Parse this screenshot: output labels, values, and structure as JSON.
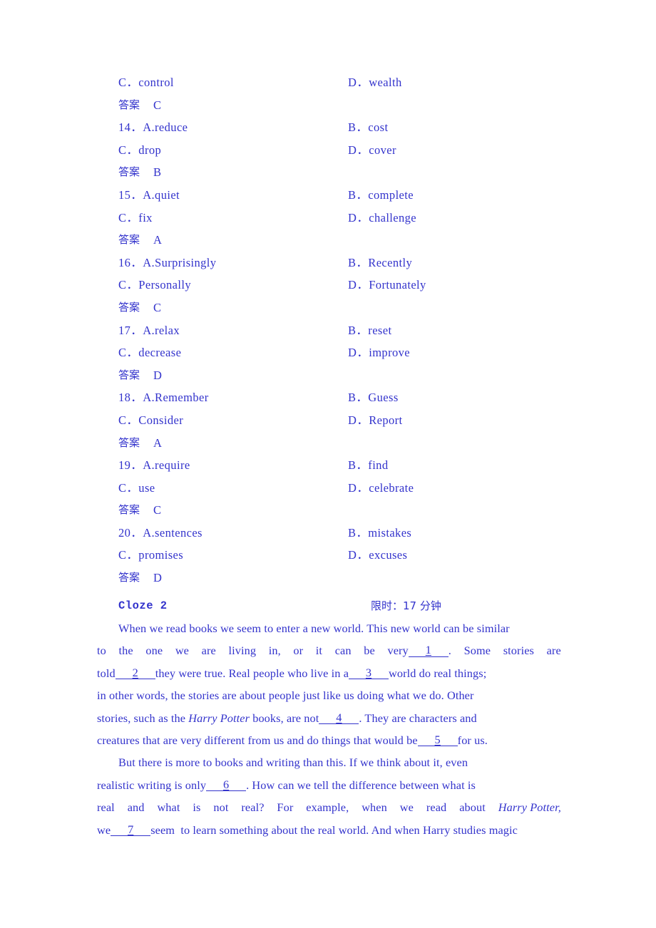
{
  "document": {
    "text_color": "#3333cc",
    "background_color": "#ffffff"
  },
  "options_block": {
    "rows": [
      {
        "type": "options",
        "left": "C．control",
        "right": "D．wealth"
      },
      {
        "type": "answer",
        "label": "答案",
        "value": "C"
      },
      {
        "type": "options",
        "left": "14．A.reduce",
        "right": "B．cost"
      },
      {
        "type": "options",
        "left": "C．drop",
        "right": "D．cover"
      },
      {
        "type": "answer",
        "label": "答案",
        "value": "B"
      },
      {
        "type": "options",
        "left": "15．A.quiet",
        "right": "B．complete"
      },
      {
        "type": "options",
        "left": "C．fix",
        "right": "D．challenge"
      },
      {
        "type": "answer",
        "label": "答案",
        "value": "A"
      },
      {
        "type": "options",
        "left": "16．A.Surprisingly",
        "right": "B．Recently"
      },
      {
        "type": "options",
        "left": "C．Personally",
        "right": "D．Fortunately"
      },
      {
        "type": "answer",
        "label": "答案",
        "value": "C"
      },
      {
        "type": "options",
        "left": "17．A.relax",
        "right": "B．reset"
      },
      {
        "type": "options",
        "left": "C．decrease",
        "right": "D．improve"
      },
      {
        "type": "answer",
        "label": "答案",
        "value": "D"
      },
      {
        "type": "options",
        "left": "18．A.Remember",
        "right": "B．Guess"
      },
      {
        "type": "options",
        "left": "C．Consider",
        "right": "D．Report"
      },
      {
        "type": "answer",
        "label": "答案",
        "value": "A"
      },
      {
        "type": "options",
        "left": "19．A.require",
        "right": "B．find"
      },
      {
        "type": "options",
        "left": "C．use",
        "right": "D．celebrate"
      },
      {
        "type": "answer",
        "label": "答案",
        "value": "C"
      },
      {
        "type": "options",
        "left": "20．A.sentences",
        "right": "B．mistakes"
      },
      {
        "type": "options",
        "left": "C．promises",
        "right": "D．excuses"
      },
      {
        "type": "answer",
        "label": "答案",
        "value": "D"
      }
    ]
  },
  "cloze_header": {
    "title": "Cloze 2",
    "time_limit": "限时：17 分钟"
  },
  "passage": {
    "lines": [
      {
        "justify": false,
        "indent": true,
        "segments": [
          {
            "kind": "text",
            "value": "When we read books we seem to enter a new world. This new world can be similar"
          }
        ]
      },
      {
        "justify": true,
        "indent": false,
        "segments": [
          {
            "kind": "text",
            "value": "to"
          },
          {
            "kind": "text",
            "value": "the"
          },
          {
            "kind": "text",
            "value": "one"
          },
          {
            "kind": "text",
            "value": "we"
          },
          {
            "kind": "text",
            "value": "are"
          },
          {
            "kind": "text",
            "value": "living"
          },
          {
            "kind": "text",
            "value": "in,"
          },
          {
            "kind": "text",
            "value": "or"
          },
          {
            "kind": "text",
            "value": "it"
          },
          {
            "kind": "text",
            "value": "can"
          },
          {
            "kind": "text",
            "value": "be"
          },
          {
            "kind": "group",
            "parts": [
              {
                "kind": "text",
                "value": "very"
              },
              {
                "kind": "blank",
                "value": "1"
              },
              {
                "kind": "text",
                "value": "."
              }
            ]
          },
          {
            "kind": "text",
            "value": "Some"
          },
          {
            "kind": "text",
            "value": "stories"
          },
          {
            "kind": "text",
            "value": "are"
          }
        ]
      },
      {
        "justify": false,
        "indent": false,
        "segments": [
          {
            "kind": "text",
            "value": "told"
          },
          {
            "kind": "blank",
            "value": "2"
          },
          {
            "kind": "text",
            "value": "they were true. Real people who live in a"
          },
          {
            "kind": "blank",
            "value": "3"
          },
          {
            "kind": "text",
            "value": "world do real things;"
          }
        ]
      },
      {
        "justify": false,
        "indent": false,
        "segments": [
          {
            "kind": "text",
            "value": "in other words, the stories are about people just like us doing what we do. Other"
          }
        ]
      },
      {
        "justify": false,
        "indent": false,
        "segments": [
          {
            "kind": "text",
            "value": "stories, such as the "
          },
          {
            "kind": "italic",
            "value": "Harry Potter"
          },
          {
            "kind": "text",
            "value": " books, are not"
          },
          {
            "kind": "blank",
            "value": "4"
          },
          {
            "kind": "text",
            "value": ". They are characters and"
          }
        ]
      },
      {
        "justify": false,
        "indent": false,
        "segments": [
          {
            "kind": "text",
            "value": "creatures that are very different from us and do things that would be"
          },
          {
            "kind": "blank",
            "value": "5"
          },
          {
            "kind": "text",
            "value": "for us."
          }
        ]
      },
      {
        "justify": false,
        "indent": true,
        "segments": [
          {
            "kind": "text",
            "value": "But there is more to books and writing than this. If we think about it, even"
          }
        ]
      },
      {
        "justify": false,
        "indent": false,
        "segments": [
          {
            "kind": "text",
            "value": "realistic writing is only"
          },
          {
            "kind": "blank",
            "value": "6"
          },
          {
            "kind": "text",
            "value": ". How can we tell the difference between what is"
          }
        ]
      },
      {
        "justify": true,
        "indent": false,
        "segments": [
          {
            "kind": "text",
            "value": "real"
          },
          {
            "kind": "text",
            "value": "and"
          },
          {
            "kind": "text",
            "value": "what"
          },
          {
            "kind": "text",
            "value": "is"
          },
          {
            "kind": "text",
            "value": "not"
          },
          {
            "kind": "text",
            "value": "real?"
          },
          {
            "kind": "text",
            "value": "For"
          },
          {
            "kind": "text",
            "value": "example,"
          },
          {
            "kind": "text",
            "value": "when"
          },
          {
            "kind": "text",
            "value": "we"
          },
          {
            "kind": "text",
            "value": "read"
          },
          {
            "kind": "text",
            "value": "about"
          },
          {
            "kind": "italic",
            "value": "Harry Potter,"
          }
        ]
      },
      {
        "justify": false,
        "indent": false,
        "segments": [
          {
            "kind": "text",
            "value": "we"
          },
          {
            "kind": "blank",
            "value": "7"
          },
          {
            "kind": "text",
            "value": "seem  to learn something about the real world. And when Harry studies magic"
          }
        ]
      }
    ]
  }
}
